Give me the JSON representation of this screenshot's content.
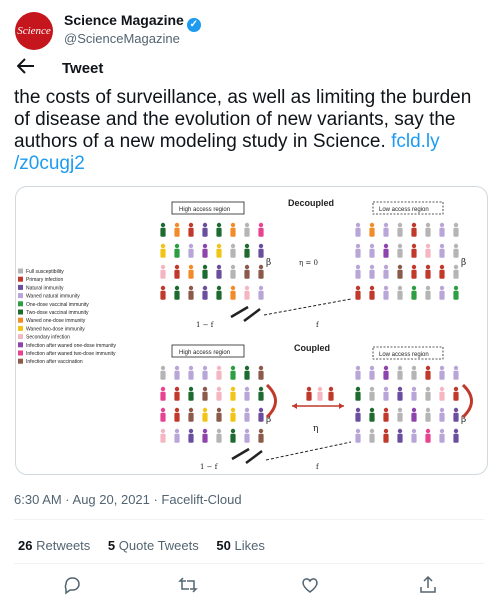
{
  "account": {
    "logo_text": "Science",
    "name": "Science Magazine",
    "handle": "@ScienceMagazine"
  },
  "header": {
    "back_icon": "arrow-left-icon",
    "title": "Tweet"
  },
  "tweet": {
    "text": "the costs of surveillance, as well as limiting the burden of disease and the evolution of new variants, say the authors of a new modeling study in Science.",
    "link": "fcld.ly /z0cugj2"
  },
  "figure": {
    "decoupled_title": "Decoupled",
    "coupled_title": "Coupled",
    "high_access": "High access region",
    "low_access": "Low access region",
    "beta": "β",
    "eta_eq": "η = 0",
    "eta": "η",
    "one_minus_f": "1 − f",
    "f": "f",
    "legend": [
      {
        "label": "Full susceptibility",
        "color": "#b5b5b5"
      },
      {
        "label": "Primary infection",
        "color": "#c0392b"
      },
      {
        "label": "Natural immunity",
        "color": "#6b4f9e"
      },
      {
        "label": "Waned natural immunity",
        "color": "#b9a6d8"
      },
      {
        "label": "One-dose vaccinal immunity",
        "color": "#2e9e43"
      },
      {
        "label": "Two-dose vaccinal immunity",
        "color": "#1e6b2f"
      },
      {
        "label": "Waned one-dose immunity",
        "color": "#f28c28"
      },
      {
        "label": "Waned two-dose immunity",
        "color": "#f2c418"
      },
      {
        "label": "Secondary infection",
        "color": "#f4b6c2"
      },
      {
        "label": "Infection after waned one-dose immunity",
        "color": "#8e44ad"
      },
      {
        "label": "Infection after waned two-dose immunity",
        "color": "#e84393"
      },
      {
        "label": "Infection after vaccination",
        "color": "#8b5a4a"
      }
    ]
  },
  "meta": {
    "time": "6:30 AM · Aug 20, 2021 · Facelift-Cloud"
  },
  "stats": {
    "retweets_count": "26",
    "retweets_label": "Retweets",
    "quotes_count": "5",
    "quotes_label": "Quote Tweets",
    "likes_count": "50",
    "likes_label": "Likes"
  },
  "actions": [
    "reply-icon",
    "retweet-icon",
    "like-icon",
    "share-icon"
  ]
}
